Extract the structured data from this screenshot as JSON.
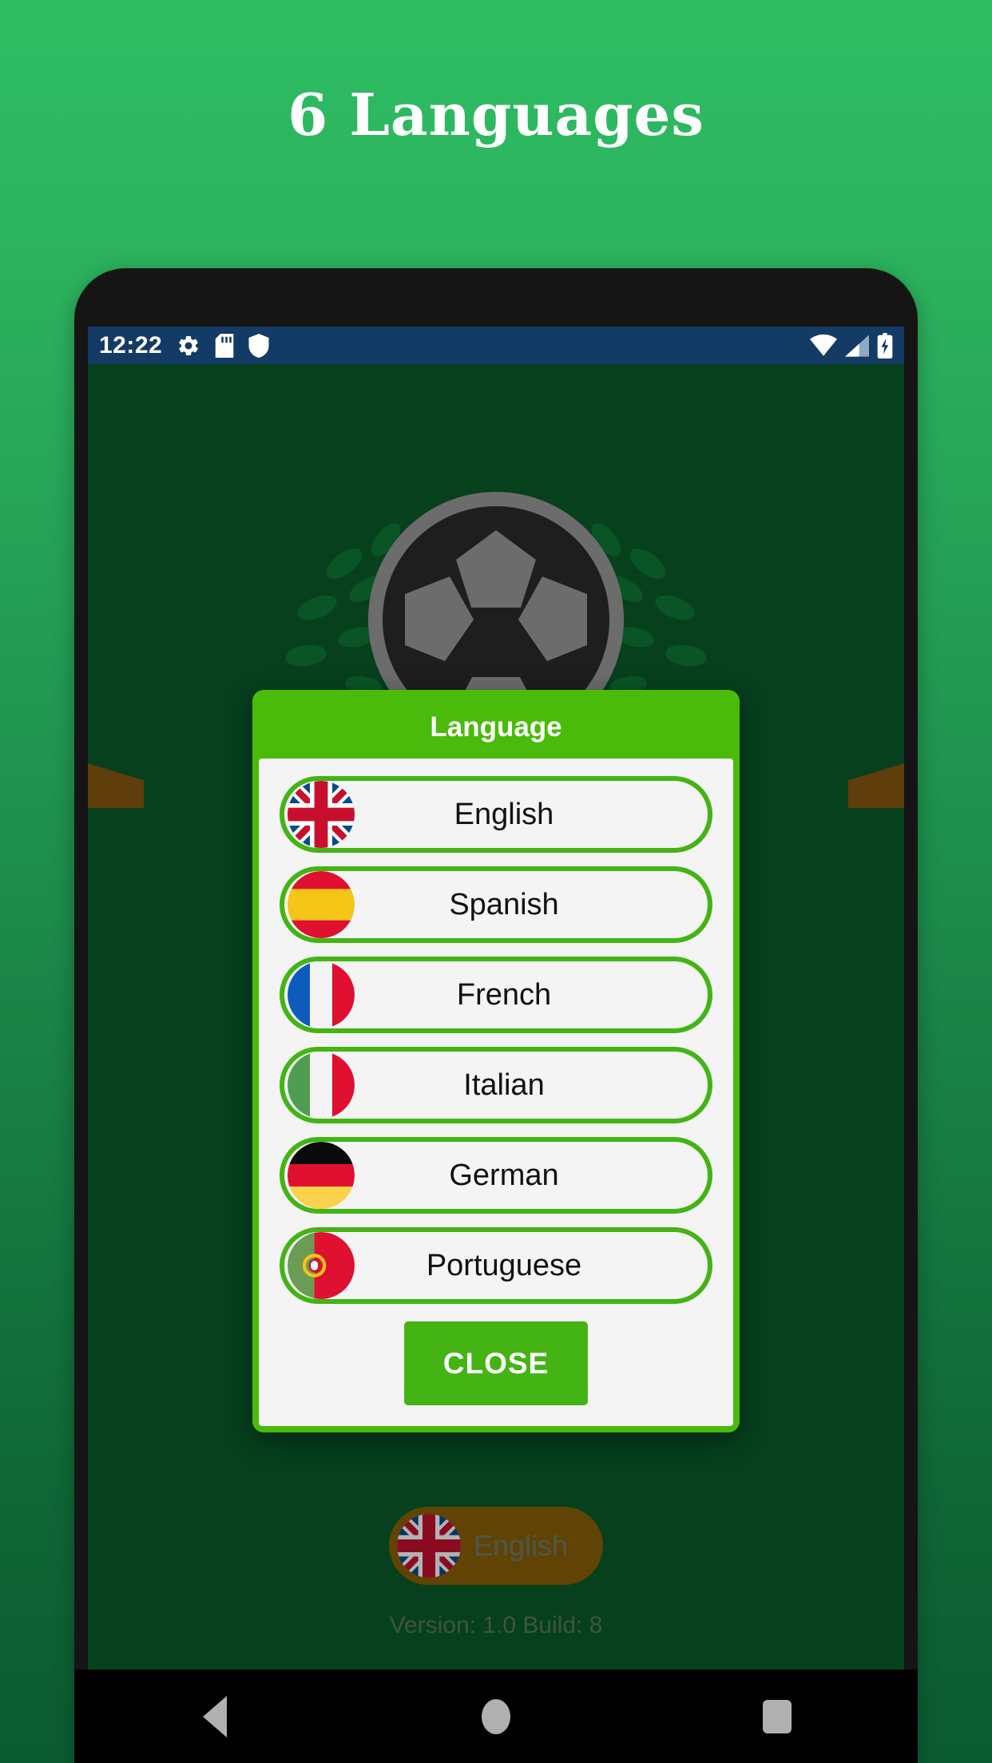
{
  "promo": {
    "title": "6 Languages"
  },
  "status_bar": {
    "time": "12:22",
    "left_icons": [
      "gear-icon",
      "sd-card-icon",
      "shield-icon"
    ],
    "right_icons": [
      "wifi-icon",
      "cellular-signal-icon",
      "battery-charging-icon"
    ],
    "background_color": "#143a66"
  },
  "dialog": {
    "title": "Language",
    "header_color": "#4aba0b",
    "body_color": "#f4f4f4",
    "border_color": "#43b414",
    "languages": [
      {
        "label": "English",
        "flag": "flag-uk-icon"
      },
      {
        "label": "Spanish",
        "flag": "flag-spain-icon"
      },
      {
        "label": "French",
        "flag": "flag-france-icon"
      },
      {
        "label": "Italian",
        "flag": "flag-italy-icon"
      },
      {
        "label": "German",
        "flag": "flag-germany-icon"
      },
      {
        "label": "Portuguese",
        "flag": "flag-portugal-icon"
      }
    ],
    "close_label": "CLOSE"
  },
  "app": {
    "selected_language": "English",
    "selected_language_flag": "flag-uk-icon",
    "version_text": "Version: 1.0 Build: 8",
    "background_color": "#0a5c2a",
    "accent_color": "#43b414",
    "chip_color": "#8a6108"
  },
  "nav_bar": {
    "items": [
      "back-icon",
      "home-icon",
      "recents-icon"
    ],
    "background_color": "#000000"
  }
}
